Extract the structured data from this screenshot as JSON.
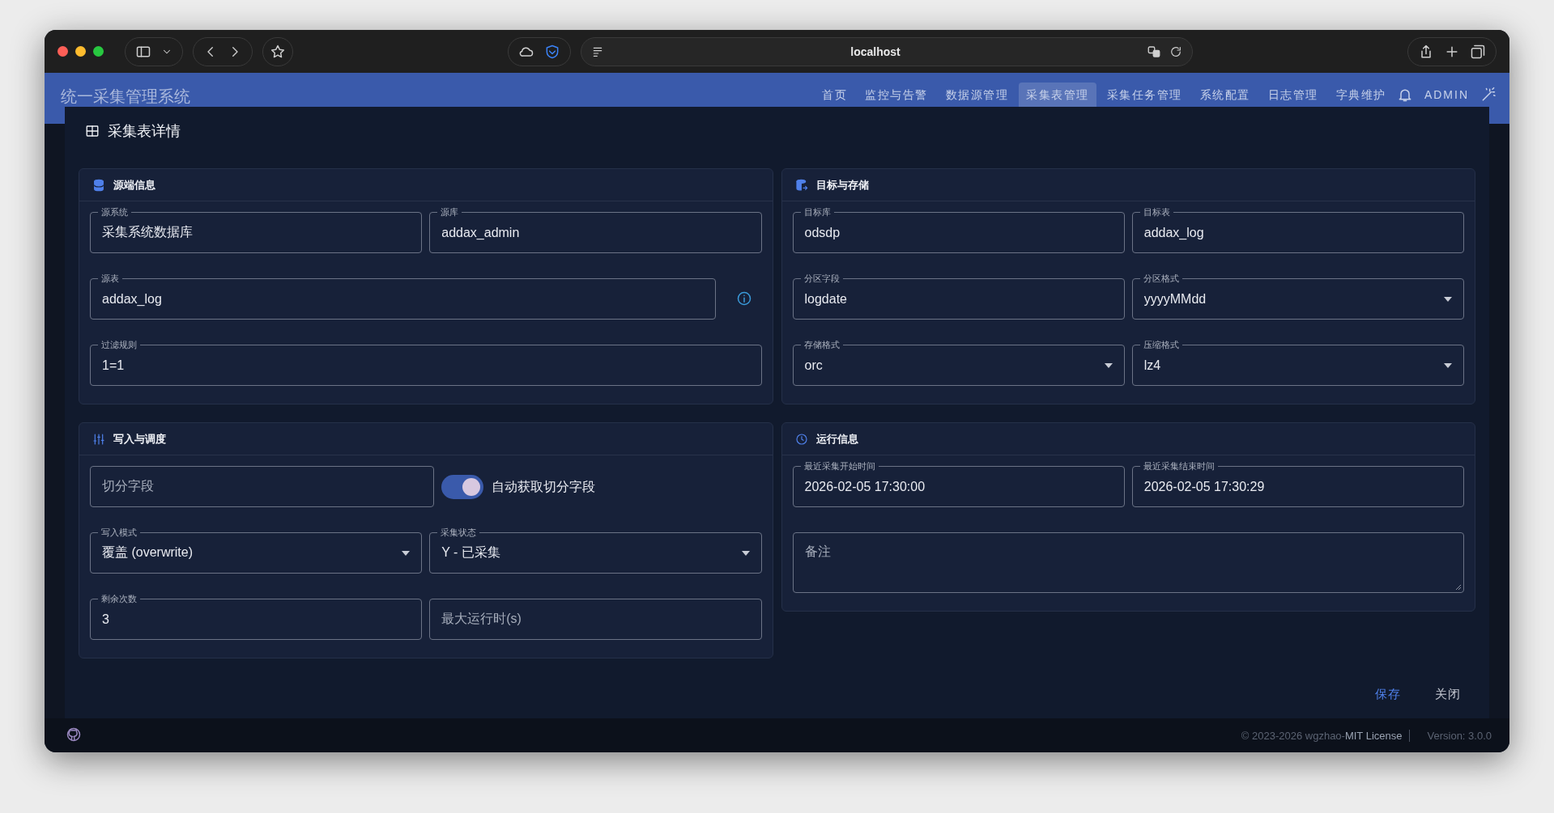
{
  "browser": {
    "address": "localhost"
  },
  "app": {
    "title": "统一采集管理系统",
    "user": "ADMIN",
    "nav": [
      {
        "label": "首页",
        "selected": false
      },
      {
        "label": "监控与告警",
        "selected": false
      },
      {
        "label": "数据源管理",
        "selected": false
      },
      {
        "label": "采集表管理",
        "selected": true
      },
      {
        "label": "采集任务管理",
        "selected": false
      },
      {
        "label": "系统配置",
        "selected": false
      },
      {
        "label": "日志管理",
        "selected": false
      },
      {
        "label": "字典维护",
        "selected": false
      }
    ]
  },
  "dialog": {
    "title": "采集表详情",
    "sections": [
      {
        "title": "源端信息",
        "rows": [
          [
            {
              "kind": "text",
              "label": "源系统",
              "value": "采集系统数据库"
            },
            {
              "kind": "text",
              "label": "源库",
              "value": "addax_admin"
            }
          ],
          [
            {
              "kind": "text",
              "label": "源表",
              "value": "addax_log",
              "info": true
            }
          ],
          [
            {
              "kind": "text",
              "label": "过滤规则",
              "value": "1=1"
            }
          ]
        ]
      },
      {
        "title": "目标与存储",
        "rows": [
          [
            {
              "kind": "text",
              "label": "目标库",
              "value": "odsdp"
            },
            {
              "kind": "text",
              "label": "目标表",
              "value": "addax_log"
            }
          ],
          [
            {
              "kind": "text",
              "label": "分区字段",
              "value": "logdate"
            },
            {
              "kind": "select",
              "label": "分区格式",
              "value": "yyyyMMdd"
            }
          ],
          [
            {
              "kind": "select",
              "label": "存储格式",
              "value": "orc"
            },
            {
              "kind": "select",
              "label": "压缩格式",
              "value": "lz4"
            }
          ]
        ]
      },
      {
        "title": "写入与调度",
        "rows": [
          [
            {
              "kind": "text",
              "placeholder": "切分字段"
            },
            {
              "kind": "toggle",
              "label": "自动获取切分字段",
              "on": true
            }
          ],
          [
            {
              "kind": "select",
              "label": "写入模式",
              "value": "覆盖 (overwrite)"
            },
            {
              "kind": "select",
              "label": "采集状态",
              "value": "Y - 已采集"
            }
          ],
          [
            {
              "kind": "text",
              "label": "剩余次数",
              "value": "3"
            },
            {
              "kind": "text",
              "placeholder": "最大运行时(s)"
            }
          ]
        ]
      },
      {
        "title": "运行信息",
        "rows": [
          [
            {
              "kind": "text",
              "label": "最近采集开始时间",
              "value": "2026-02-05 17:30:00"
            },
            {
              "kind": "text",
              "label": "最近采集结束时间",
              "value": "2026-02-05 17:30:29"
            }
          ],
          [
            {
              "kind": "textarea",
              "placeholder": "备注"
            }
          ]
        ]
      }
    ],
    "buttons": [
      {
        "label": "保存",
        "kind": "primary"
      },
      {
        "label": "关闭",
        "kind": "plain"
      }
    ]
  },
  "footer": {
    "copyright": "© 2023-2026 wgzhao-",
    "license": "MIT License",
    "version": "Version: 3.0.0"
  }
}
